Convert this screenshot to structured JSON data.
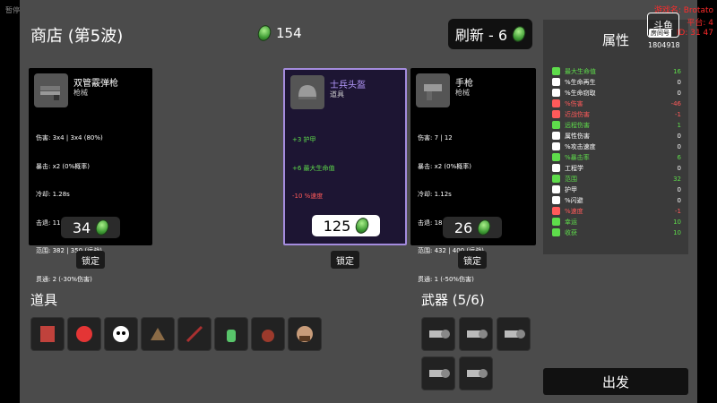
{
  "top_left_label": "暂停",
  "shop": {
    "title": "商店 (第5波)",
    "money": "154",
    "refresh_label": "刷新 - 6"
  },
  "cards": [
    {
      "name": "双管霰弹枪",
      "type": "枪械",
      "price": "34",
      "lock": "锁定",
      "stats": [
        "伤害: 3x4 | 3x4 (80%)",
        "暴击: x2 (0%概率)",
        "冷却: 1.28s",
        "击退: 11",
        "范围: 382 | 350 (远战)",
        "贯通: 2 (-30%伤害)"
      ]
    },
    {
      "name": "士兵头盔",
      "type": "道具",
      "price": "125",
      "lock": "锁定",
      "stats": [
        "+3 护甲",
        "+6 最大生命值",
        "-10 %速度"
      ]
    },
    {
      "name": "手枪",
      "type": "枪械",
      "price": "26",
      "lock": "锁定",
      "stats": [
        "伤害: 7 | 12",
        "暴击: x2 (0%概率)",
        "冷却: 1.12s",
        "击退: 18",
        "范围: 432 | 400 (远战)",
        "贯通: 1 (-50%伤害)"
      ]
    }
  ],
  "attributes": {
    "title": "属性",
    "rows": [
      {
        "name": "最大生命值",
        "value": "16",
        "color": "#5edc4b"
      },
      {
        "name": "%生命再生",
        "value": "0",
        "color": "#ffffff"
      },
      {
        "name": "%生命窃取",
        "value": "0",
        "color": "#ffffff"
      },
      {
        "name": "%伤害",
        "value": "-46",
        "color": "#ff5a5a"
      },
      {
        "name": "近战伤害",
        "value": "-1",
        "color": "#ff5a5a"
      },
      {
        "name": "远程伤害",
        "value": "1",
        "color": "#5edc4b"
      },
      {
        "name": "属性伤害",
        "value": "0",
        "color": "#ffffff"
      },
      {
        "name": "%攻击速度",
        "value": "0",
        "color": "#ffffff"
      },
      {
        "name": "%暴击率",
        "value": "6",
        "color": "#5edc4b"
      },
      {
        "name": "工程学",
        "value": "0",
        "color": "#ffffff"
      },
      {
        "name": "范围",
        "value": "32",
        "color": "#5edc4b"
      },
      {
        "name": "护甲",
        "value": "0",
        "color": "#ffffff"
      },
      {
        "name": "%闪避",
        "value": "0",
        "color": "#ffffff"
      },
      {
        "name": "%速度",
        "value": "-1",
        "color": "#ff5a5a"
      },
      {
        "name": "幸运",
        "value": "10",
        "color": "#5edc4b"
      },
      {
        "name": "收获",
        "value": "10",
        "color": "#5edc4b"
      }
    ]
  },
  "items_label": "道具",
  "weapons_label": "武器 (5/6)",
  "go_label": "出发",
  "overlay": {
    "line1": "游戏名: Brotato",
    "line2": "平台: 4",
    "line3": "ID: 31        47",
    "logo": "斗鱼",
    "room_label": "房间号",
    "room_id": "1804918"
  }
}
